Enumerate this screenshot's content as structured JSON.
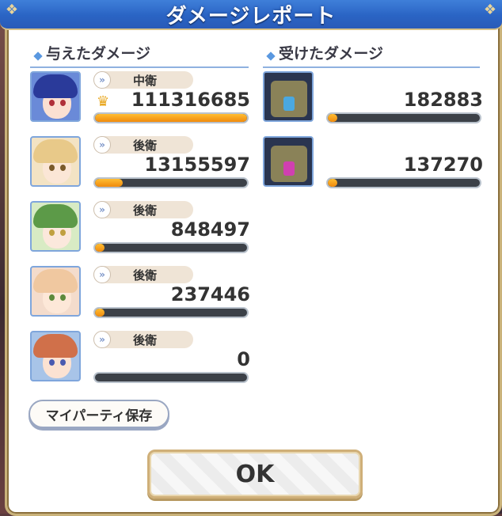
{
  "title": "ダメージレポート",
  "dealt": {
    "header": "与えたダメージ",
    "rows": [
      {
        "role": "中衛",
        "value": "111316685",
        "fill": 1.0,
        "crown": true,
        "hair": "#2a3a9a",
        "skin": "#fbe0d2",
        "eye": "#b0303a",
        "bg": "#6a8ad8"
      },
      {
        "role": "後衛",
        "value": "13155597",
        "fill": 0.18,
        "crown": false,
        "hair": "#e8c989",
        "skin": "#fbe6d6",
        "eye": "#7a5a2a",
        "bg": "#f3e3c4"
      },
      {
        "role": "後衛",
        "value": "848497",
        "fill": 0.04,
        "crown": false,
        "hair": "#5c9a48",
        "skin": "#fbe8dc",
        "eye": "#c0a040",
        "bg": "#d8ebc4"
      },
      {
        "role": "後衛",
        "value": "237446",
        "fill": 0.04,
        "crown": false,
        "hair": "#f0c8a0",
        "skin": "#fde8d8",
        "eye": "#5c8a3c",
        "bg": "#f4dccc"
      },
      {
        "role": "後衛",
        "value": "0",
        "fill": 0.0,
        "crown": false,
        "hair": "#d0704a",
        "skin": "#fce2d2",
        "eye": "#4a5ab0",
        "bg": "#a8c4e8"
      }
    ]
  },
  "received": {
    "header": "受けたダメージ",
    "rows": [
      {
        "value": "182883",
        "fill": 0.05,
        "accent": "#4aa8e0"
      },
      {
        "value": "137270",
        "fill": 0.04,
        "accent": "#d040b0"
      }
    ]
  },
  "buttons": {
    "save_party": "マイパーティ保存",
    "ok": "OK"
  },
  "colors": {
    "title_bar": "#2a64c4",
    "bar_fill": "#f08a0c",
    "bar_track": "#3c4148"
  }
}
